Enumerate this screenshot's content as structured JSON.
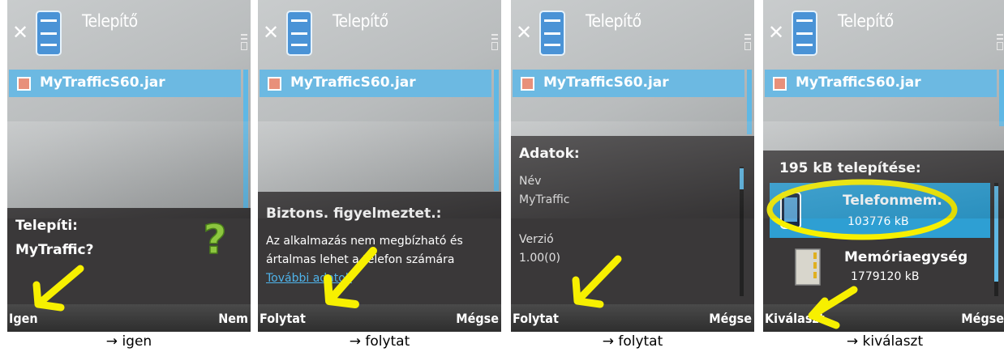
{
  "screens": [
    {
      "title": "Telepítő",
      "file": "MyTrafficS60.jar",
      "dialog_title": "Telepíti:",
      "dialog_text": "MyTraffic?",
      "left_softkey": "Igen",
      "right_softkey": "Nem",
      "caption": "→ igen"
    },
    {
      "title": "Telepítő",
      "file": "MyTrafficS60.jar",
      "dialog_title": "Biztons. figyelmeztet.:",
      "dialog_text_1": "Az alkalmazás nem megbízható és",
      "dialog_text_2": "ártalmas lehet a telefon számára",
      "dialog_link": "További adatok",
      "left_softkey": "Folytat",
      "right_softkey": "Mégse",
      "caption": "→ folytat"
    },
    {
      "title": "Telepítő",
      "file": "MyTrafficS60.jar",
      "dialog_title": "Adatok:",
      "name_label": "Név",
      "name_value": "MyTraffic",
      "version_label": "Verzió",
      "version_value": "1.00(0)",
      "left_softkey": "Folytat",
      "right_softkey": "Mégse",
      "caption": "→ folytat"
    },
    {
      "title": "Telepítő",
      "file": "MyTrafficS60.jar",
      "dialog_title": "195 kB telepítése:",
      "option1_name": "Telefonmem.",
      "option1_size": "103776 kB",
      "option2_name": "Memóriaegység",
      "option2_size": "1779120 kB",
      "left_softkey": "Kiválaszt",
      "right_softkey": "Mégse",
      "caption": "→ kiválaszt"
    }
  ],
  "colors": {
    "highlight": "#6cb9e2",
    "dialog": "#3a3839",
    "annotation": "#f7f000",
    "link": "#4fb3ea"
  },
  "icons": [
    "close-icon",
    "installer-app-icon",
    "options-indicator-icon",
    "checkbox-icon",
    "help-icon",
    "phone-memory-icon",
    "memory-card-icon"
  ]
}
